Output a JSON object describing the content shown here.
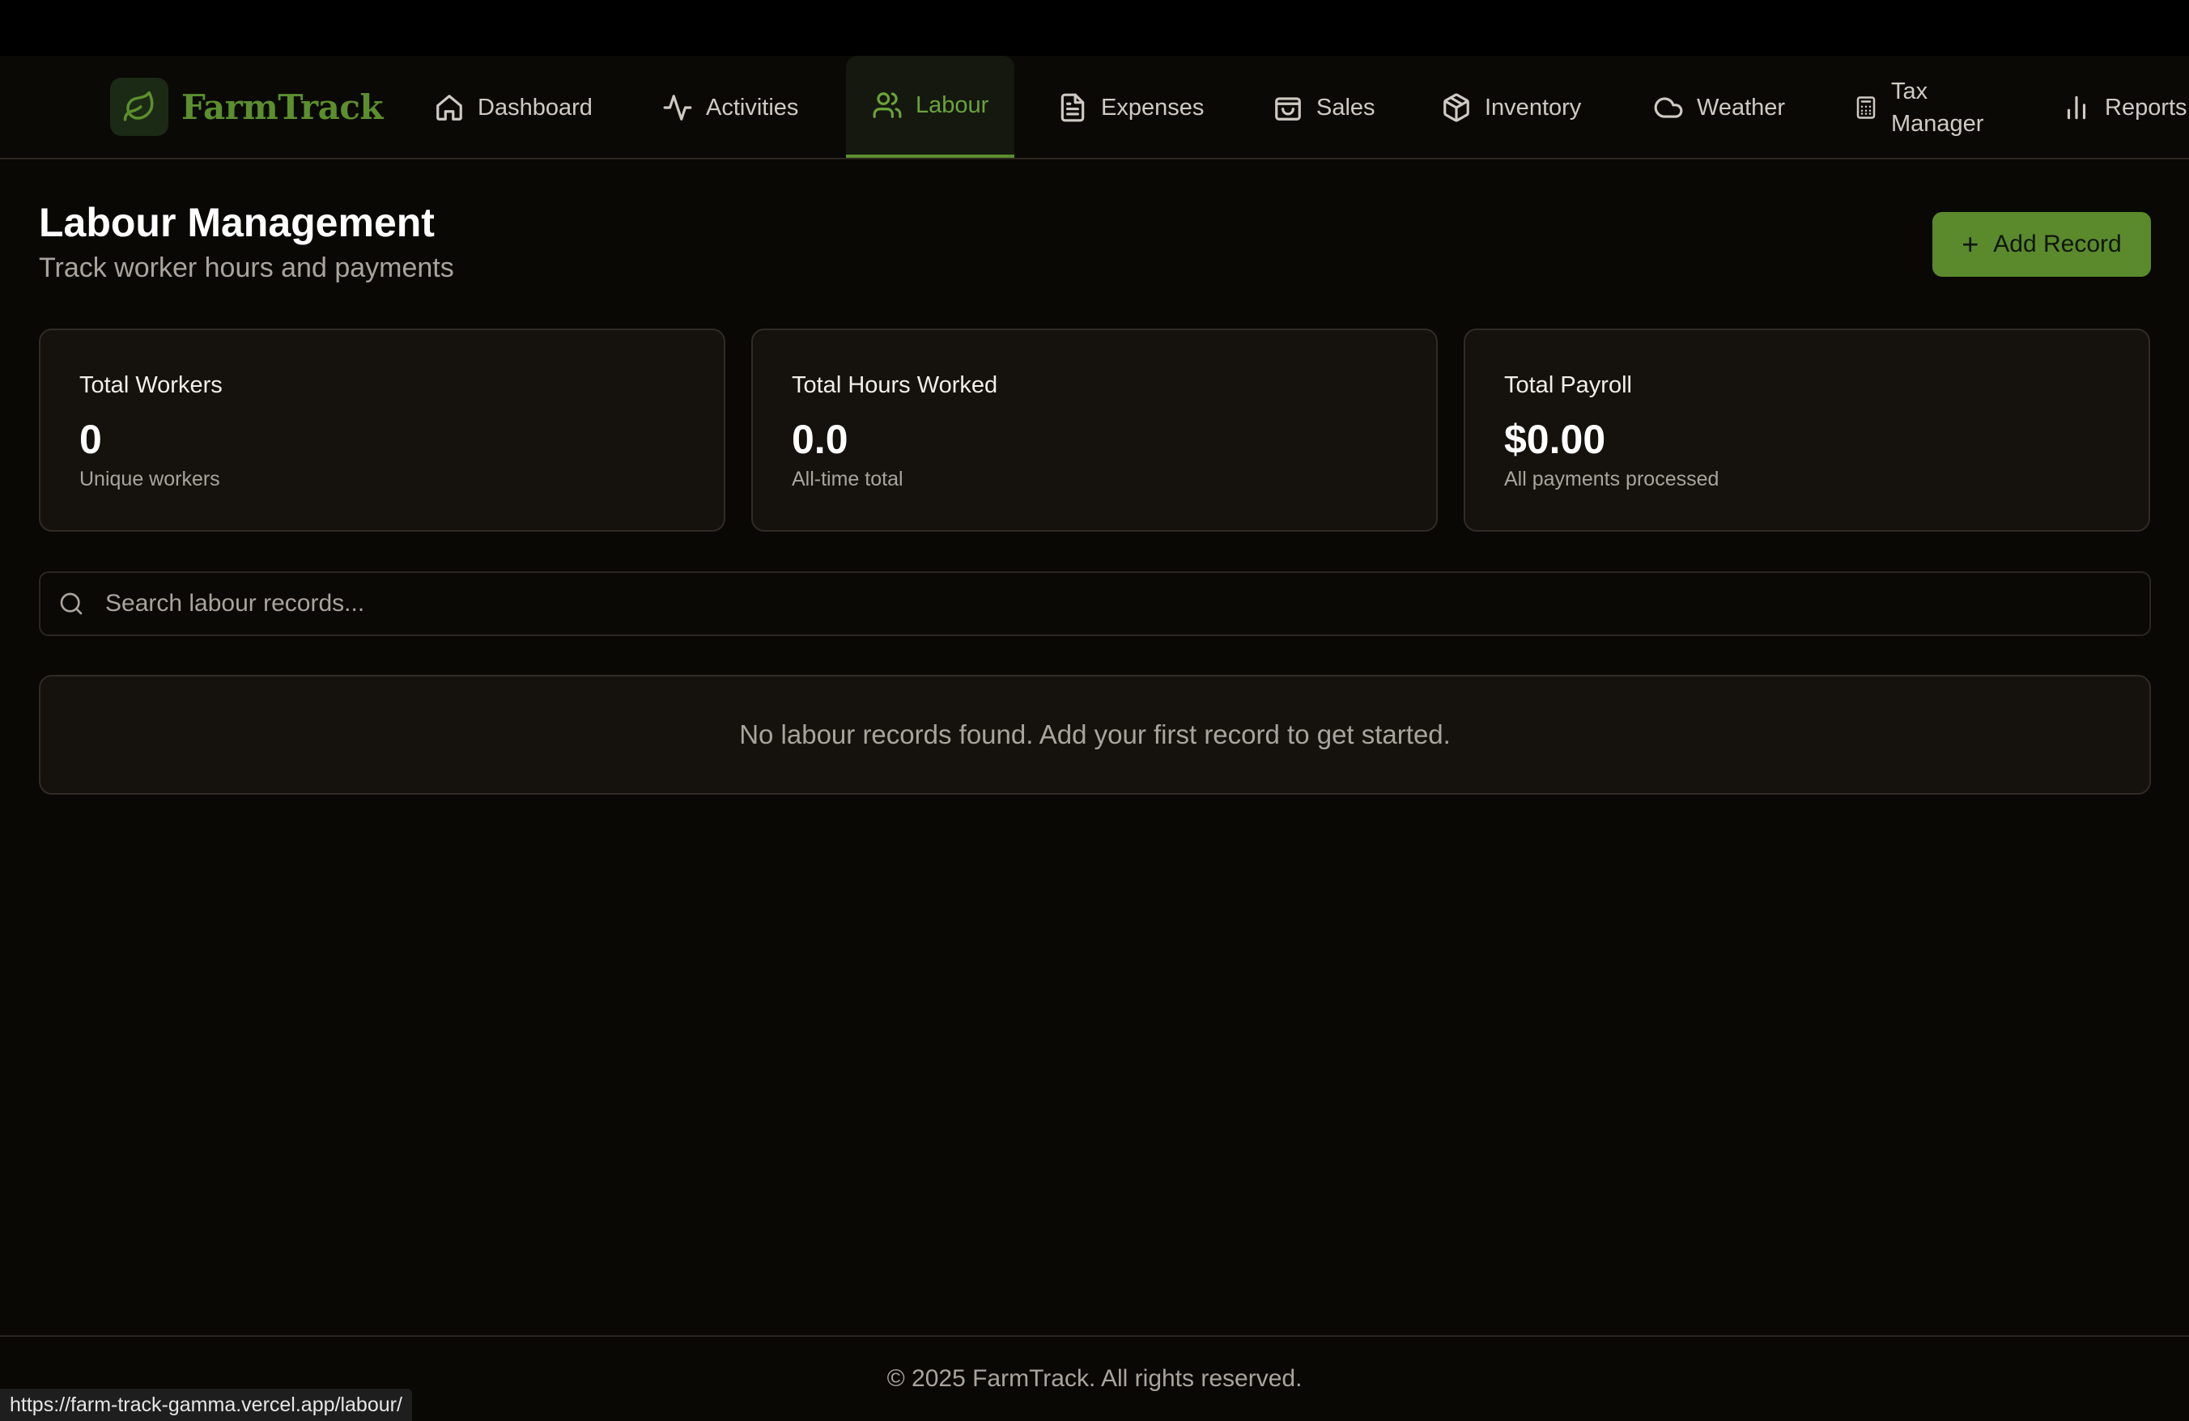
{
  "app": {
    "name": "FarmTrack",
    "accent_color": "#5b8f2e",
    "logo_icon": "leaf-icon"
  },
  "nav": {
    "items": [
      {
        "label": "Dashboard",
        "icon": "home-icon"
      },
      {
        "label": "Activities",
        "icon": "activity-icon"
      },
      {
        "label": "Labour",
        "icon": "users-icon",
        "active": true
      },
      {
        "label": "Expenses",
        "icon": "file-text-icon"
      },
      {
        "label": "Sales",
        "icon": "shopping-bag-icon"
      },
      {
        "label": "Inventory",
        "icon": "package-icon"
      },
      {
        "label": "Weather",
        "icon": "cloud-icon"
      },
      {
        "label": "Tax Manager",
        "icon": "calculator-icon"
      },
      {
        "label": "Reports",
        "icon": "bar-chart-icon"
      }
    ]
  },
  "page": {
    "title": "Labour Management",
    "subtitle": "Track worker hours and payments",
    "add_button_label": "Add Record"
  },
  "stats": [
    {
      "label": "Total Workers",
      "value": "0",
      "caption": "Unique workers"
    },
    {
      "label": "Total Hours Worked",
      "value": "0.0",
      "caption": "All-time total"
    },
    {
      "label": "Total Payroll",
      "value": "$0.00",
      "caption": "All payments processed"
    }
  ],
  "search": {
    "placeholder": "Search labour records...",
    "value": ""
  },
  "empty_state": {
    "message": "No labour records found. Add your first record to get started."
  },
  "footer": {
    "text": "© 2025 FarmTrack. All rights reserved."
  },
  "status_bar": {
    "url": "https://farm-track-gamma.vercel.app/labour/"
  }
}
